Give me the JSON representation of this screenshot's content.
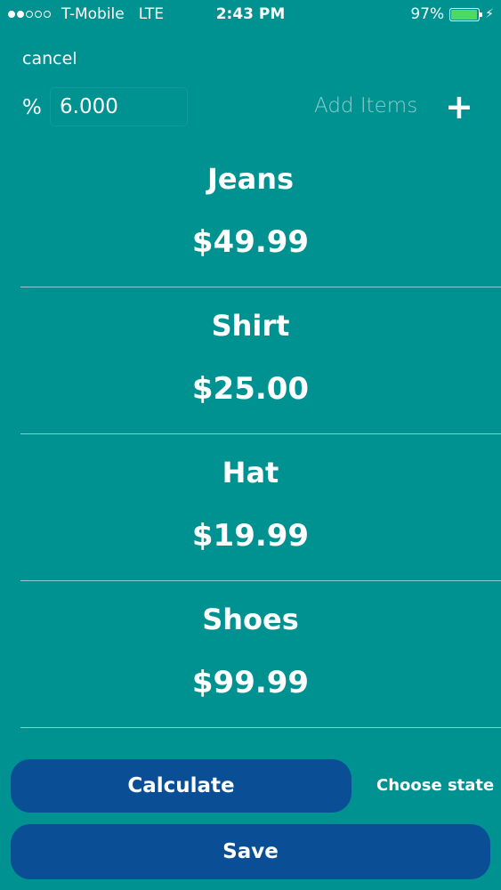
{
  "status_bar": {
    "carrier": "T-Mobile",
    "network": "LTE",
    "time": "2:43 PM",
    "battery_percent": "97%",
    "battery_level": 0.97,
    "signal_bars_filled": 2,
    "signal_bars_total": 5
  },
  "header": {
    "cancel_label": "cancel",
    "tax_symbol": "%",
    "tax_value": "6.000",
    "add_items_label": "Add Items",
    "add_icon_glyph": "+"
  },
  "items": [
    {
      "name": "Jeans",
      "price": "$49.99"
    },
    {
      "name": "Shirt",
      "price": "$25.00"
    },
    {
      "name": "Hat",
      "price": "$19.99"
    },
    {
      "name": "Shoes",
      "price": "$99.99"
    }
  ],
  "footer": {
    "calculate_label": "Calculate",
    "choose_state_label": "Choose state",
    "save_label": "Save"
  },
  "colors": {
    "background": "#009191",
    "button": "#0a4f96",
    "battery": "#4cd964"
  }
}
